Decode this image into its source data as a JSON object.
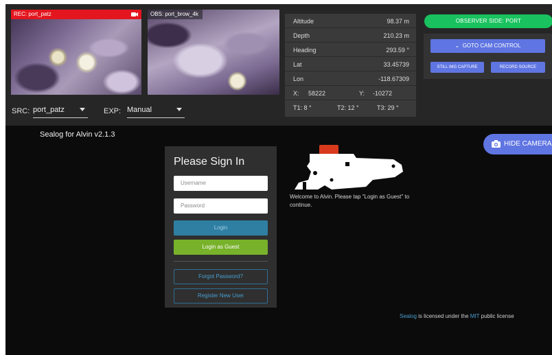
{
  "cameras": {
    "rec": {
      "label": "REC: port_patz"
    },
    "obs": {
      "label": "OBS: port_brow_4k"
    }
  },
  "source": {
    "src_label": "SRC:",
    "src_value": "port_patz",
    "exp_label": "EXP:",
    "exp_value": "Manual"
  },
  "telemetry": {
    "rows": [
      {
        "key": "Altitude",
        "value": "98.37 m"
      },
      {
        "key": "Depth",
        "value": "210.23 m"
      },
      {
        "key": "Heading",
        "value": "293.59 °"
      },
      {
        "key": "Lat",
        "value": "33.45739"
      },
      {
        "key": "Lon",
        "value": "-118.67309"
      }
    ],
    "x_label": "X:",
    "x_value": "58222",
    "y_label": "Y:",
    "y_value": "-10272",
    "t1": "T1: 8 °",
    "t2": "T2: 12 °",
    "t3": "T3: 29 °"
  },
  "observer": {
    "side_label": "OBSERVER SIDE: PORT",
    "goto_label": "GOTO CAM CONTROL",
    "still_label": "STILL IMG CAPTURE",
    "record_label": "RECORD SOURCE"
  },
  "app_title": "Sealog for Alvin v2.1.3",
  "hide_camera_label": "HIDE CAMERA",
  "signin": {
    "title": "Please Sign In",
    "username_placeholder": "Username",
    "password_placeholder": "Password",
    "login_label": "Login",
    "guest_label": "Login as Guest",
    "forgot_label": "Forgot Password?",
    "register_label": "Register New User"
  },
  "welcome_text": "Welcome to Alvin. Please tap \"Login as Guest\" to continue.",
  "license": {
    "sealog": "Sealog",
    "middle": " is licensed under the ",
    "mit": "MIT",
    "end": " public license"
  },
  "colors": {
    "rec_red": "#e3161f",
    "observer_green": "#19c25e",
    "accent_blue": "#5f75e2",
    "login_blue": "#2f7fa3",
    "guest_green": "#78b22a",
    "link_blue": "#4a9fd0"
  },
  "icons": [
    "video-camera-icon",
    "chevron-down-icon",
    "camera-icon",
    "submarine-logo"
  ]
}
